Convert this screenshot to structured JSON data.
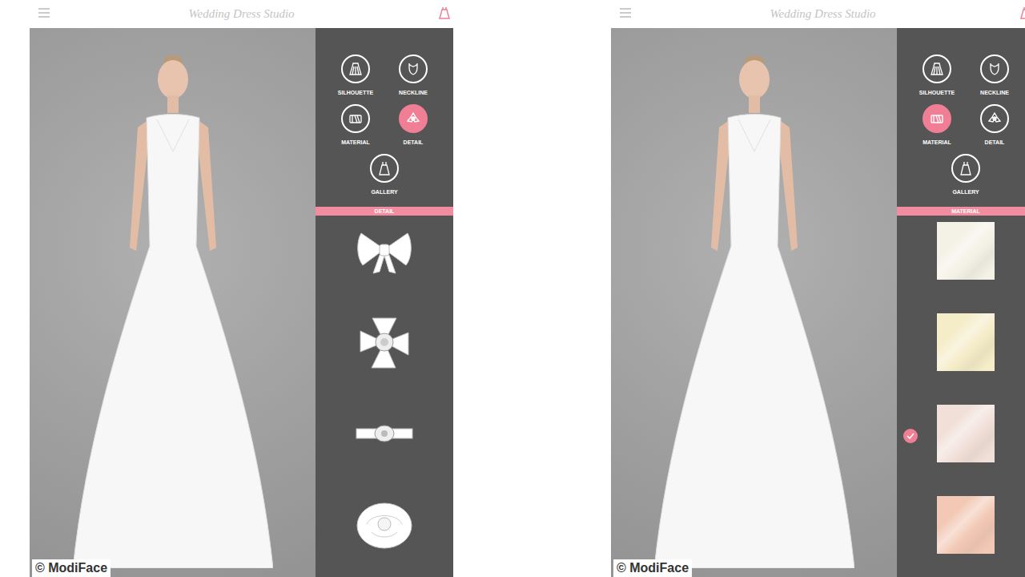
{
  "screens": [
    {
      "title": "Wedding Dress Studio",
      "tools": [
        {
          "label": "SILHOUETTE",
          "selected": false
        },
        {
          "label": "NECKLINE",
          "selected": false
        },
        {
          "label": "MATERIAL",
          "selected": false
        },
        {
          "label": "DETAIL",
          "selected": true
        },
        {
          "label": "GALLERY",
          "selected": false
        }
      ],
      "section": "DETAIL",
      "options": [
        {
          "kind": "bow",
          "selected": false
        },
        {
          "kind": "brooch",
          "selected": false
        },
        {
          "kind": "belt",
          "selected": false
        },
        {
          "kind": "rose",
          "selected": false
        }
      ],
      "watermark": "© ModiFace"
    },
    {
      "title": "Wedding Dress Studio",
      "tools": [
        {
          "label": "SILHOUETTE",
          "selected": false
        },
        {
          "label": "NECKLINE",
          "selected": false
        },
        {
          "label": "MATERIAL",
          "selected": true
        },
        {
          "label": "DETAIL",
          "selected": false
        },
        {
          "label": "GALLERY",
          "selected": false
        }
      ],
      "section": "MATERIAL",
      "options": [
        {
          "kind": "swatch",
          "color": "#f4f1e6",
          "selected": false
        },
        {
          "kind": "swatch",
          "color": "#f5ecc8",
          "selected": false
        },
        {
          "kind": "swatch",
          "color": "#f1e0d8",
          "selected": true
        },
        {
          "kind": "swatch",
          "color": "#f3c9b6",
          "selected": false
        }
      ],
      "watermark": "© ModiFace"
    }
  ]
}
